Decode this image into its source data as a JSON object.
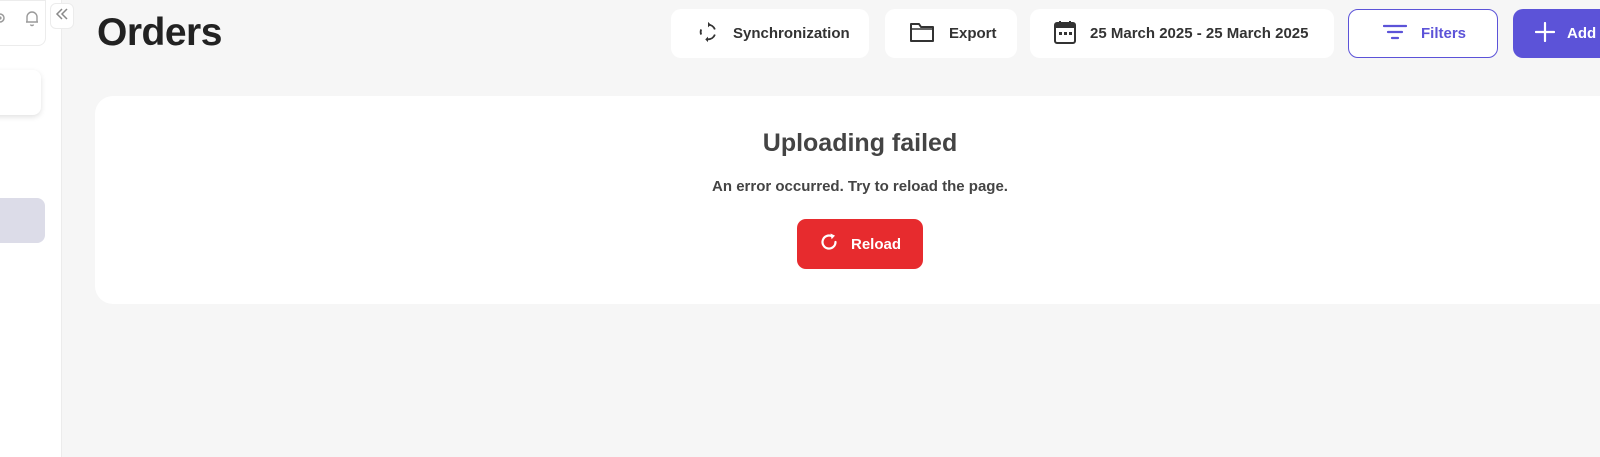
{
  "sidebar": {
    "icons": [
      "gear-icon",
      "bell-icon",
      "collapse-icon"
    ]
  },
  "header": {
    "title": "Orders",
    "sync_label": "Synchronization",
    "export_label": "Export",
    "date_range": "25 March 2025 - 25 March 2025",
    "filters_label": "Filters",
    "add_label": "Add"
  },
  "error": {
    "title": "Uploading failed",
    "message": "An error occurred. Try to reload the page.",
    "reload_label": "Reload"
  },
  "colors": {
    "accent": "#5c53d8",
    "danger": "#e72b2e",
    "background": "#f6f6f6"
  }
}
